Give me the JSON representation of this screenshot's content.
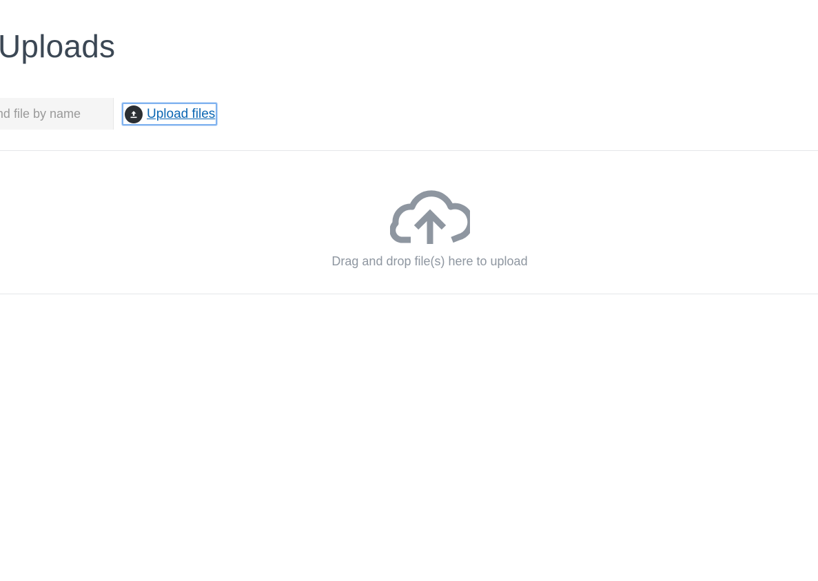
{
  "page": {
    "title": "Uploads"
  },
  "toolbar": {
    "search_placeholder": "Find file by name",
    "upload_label": "Upload files"
  },
  "dropzone": {
    "text": "Drag and drop file(s) here to upload",
    "icon": "cloud-upload-icon"
  },
  "colors": {
    "title": "#3b4754",
    "link": "#0a66b3",
    "focus_ring": "#7fb2ef",
    "muted": "#8e96a0"
  }
}
